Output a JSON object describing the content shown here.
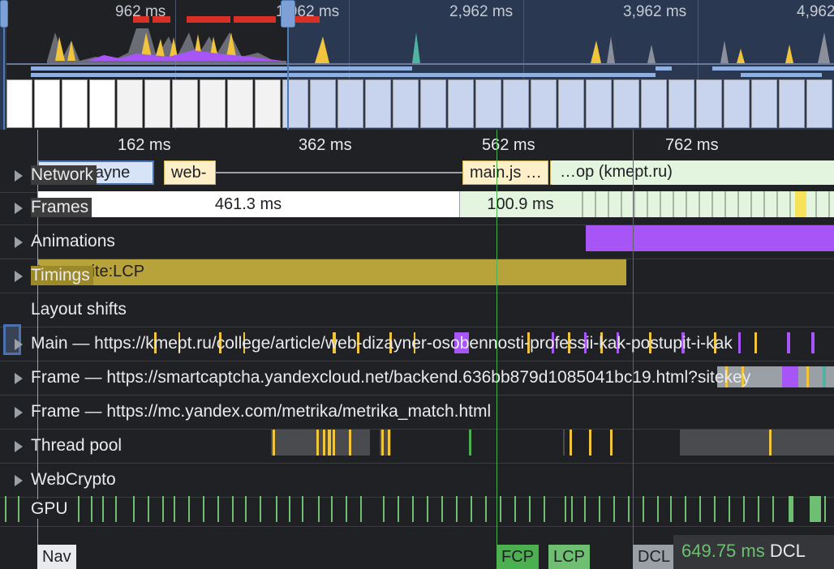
{
  "overview": {
    "ticks": [
      "962 ms",
      "1,962 ms",
      "2,962 ms",
      "3,962 ms",
      "4,962 ms"
    ]
  },
  "ruler": {
    "ticks": [
      "162 ms",
      "362 ms",
      "562 ms",
      "762 ms"
    ]
  },
  "tracks": {
    "network": {
      "label": "Network",
      "items": [
        "web-dizayne",
        "web-",
        "main.js …",
        "…",
        "…op (kmept.ru)"
      ]
    },
    "frames": {
      "label": "Frames",
      "durations": [
        "461.3 ms",
        "100.9 ms"
      ]
    },
    "animations": {
      "label": "Animations"
    },
    "timings": {
      "label": "Timings",
      "bar": "Composite:LCP"
    },
    "layout_shifts": {
      "label": "Layout shifts"
    },
    "main": {
      "label": "Main — https://kmept.ru/college/article/web-dizayner-osobennosti-professii-kak-postupit-i-kak"
    },
    "frame1": {
      "label": "Frame — https://smartcaptcha.yandexcloud.net/backend.636bb879d1085041bc19.html?sitekey"
    },
    "frame2": {
      "label": "Frame — https://mc.yandex.com/metrika/metrika_match.html"
    },
    "thread_pool": {
      "label": "Thread pool"
    },
    "webcrypto": {
      "label": "WebCrypto"
    },
    "gpu": {
      "label": "GPU"
    }
  },
  "markers": {
    "nav": "Nav",
    "fcp": "FCP",
    "lcp": "LCP",
    "dcl": "DCL"
  },
  "tooltip": {
    "time": "649.75 ms",
    "event": "DCL"
  },
  "colors": {
    "animation": "#a855f7",
    "timing": "#b8a23a",
    "fcp": "#4caf50",
    "lcp": "#4caf50",
    "scripting": "#f0c43c",
    "network_bar": "#d7e4f8",
    "frame_good": "#e3f4df"
  }
}
